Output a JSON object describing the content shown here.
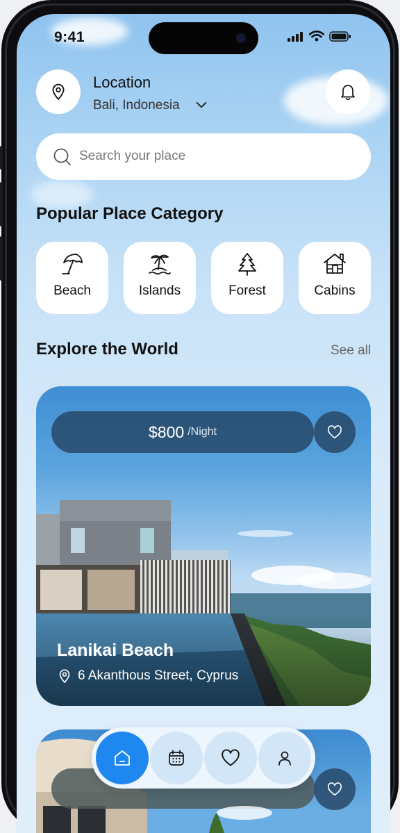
{
  "status_bar": {
    "time": "9:41"
  },
  "header": {
    "location_title": "Location",
    "location_value": "Bali, Indonesia"
  },
  "search": {
    "placeholder": "Search your place"
  },
  "categories_section": {
    "title": "Popular Place Category",
    "items": [
      {
        "label": "Beach",
        "icon": "beach-umbrella-icon"
      },
      {
        "label": "Islands",
        "icon": "palm-island-icon"
      },
      {
        "label": "Forest",
        "icon": "pine-tree-icon"
      },
      {
        "label": "Cabins",
        "icon": "cabin-icon"
      }
    ]
  },
  "explore_section": {
    "title": "Explore the World",
    "see_all": "See all"
  },
  "featured_card": {
    "price": "$800",
    "price_unit": "/Night",
    "name": "Lanikai Beach",
    "address": "6 Akanthous Street, Cyprus"
  },
  "bottom_nav": {
    "items": [
      "home-icon",
      "calendar-icon",
      "heart-icon",
      "profile-icon"
    ],
    "active": "home-icon"
  },
  "colors": {
    "accent": "#1f88f0",
    "overlay": "#264664",
    "sky_top": "#8fc3ef"
  }
}
